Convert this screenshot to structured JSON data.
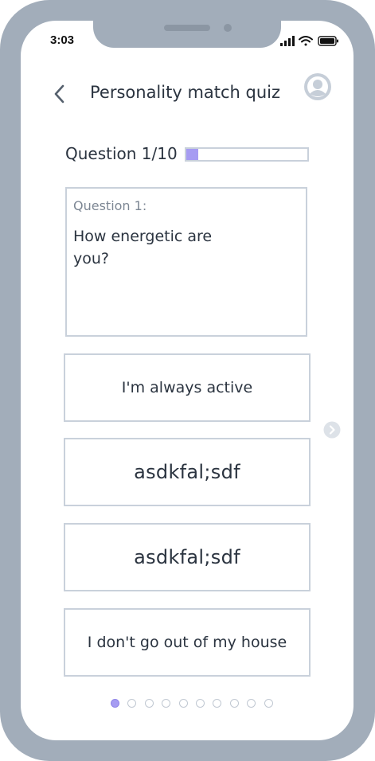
{
  "status_bar": {
    "time": "3:03",
    "icons": [
      "signal-icon",
      "wifi-icon",
      "battery-icon"
    ]
  },
  "header": {
    "back_icon": "chevron-left-icon",
    "title": "Personality match quiz",
    "avatar_icon": "user-avatar-icon"
  },
  "progress": {
    "label": "Question 1/10",
    "current": 1,
    "total": 10,
    "fraction": 0.1
  },
  "question": {
    "label": "Question 1:",
    "text": "How energetic are you?"
  },
  "answers": [
    {
      "label": "I'm always active"
    },
    {
      "label": "asdkfal;sdf"
    },
    {
      "label": "asdkfal;sdf"
    },
    {
      "label": "I don't go out of my house"
    }
  ],
  "navigation": {
    "next_icon": "chevron-right-icon",
    "page_count": 10,
    "active_page": 1
  },
  "colors": {
    "frame": "#a2adba",
    "accent": "#a69cf2",
    "border": "#c9d1db",
    "text": "#2b3440",
    "muted_text": "#7d8794"
  }
}
